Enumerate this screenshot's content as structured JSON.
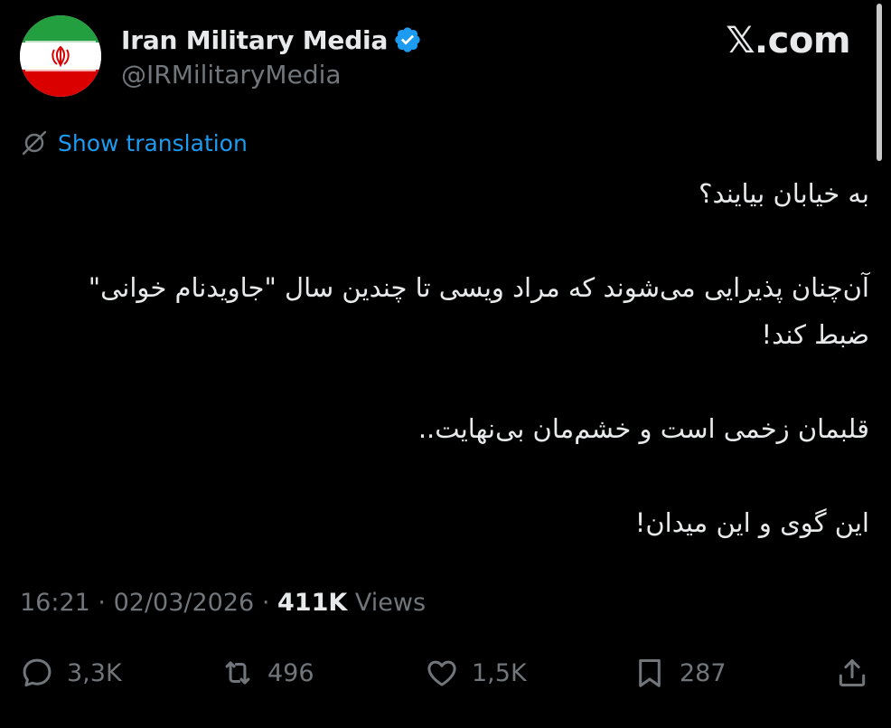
{
  "header": {
    "display_name": "Iran Military Media",
    "handle": "@IRMilitaryMedia",
    "site_label": "𝕏.com",
    "verified_icon": "verified-badge-icon",
    "avatar_icon": "iran-flag-avatar"
  },
  "translation": {
    "icon": "globe-slash-icon",
    "label": "Show translation"
  },
  "body": {
    "paragraphs": [
      "به خیابان بیایند؟",
      "آن‌چنان پذیرایی می‌شوند که مراد ویسی تا چندین سال \"جاویدنام خوانی\" ضبط کند!",
      "قلبمان زخمی است و خشم‌مان بی‌نهایت..",
      "این گوی و این میدان!"
    ]
  },
  "meta": {
    "time": "16:21",
    "separator": "·",
    "date": "02/03/2026",
    "views_count": "411K",
    "views_label": "Views"
  },
  "actions": {
    "reply": {
      "icon": "reply-icon",
      "count": "3,3K"
    },
    "repost": {
      "icon": "repost-icon",
      "count": "496"
    },
    "like": {
      "icon": "heart-icon",
      "count": "1,5K"
    },
    "bookmark": {
      "icon": "bookmark-icon",
      "count": "287"
    },
    "share": {
      "icon": "share-icon"
    }
  },
  "colors": {
    "background": "#000000",
    "primary_text": "#e7e9ea",
    "secondary_text": "#71767b",
    "link": "#1d9bf0",
    "verified": "#1d9bf0",
    "flag_green": "#239f40",
    "flag_red": "#da0000"
  }
}
